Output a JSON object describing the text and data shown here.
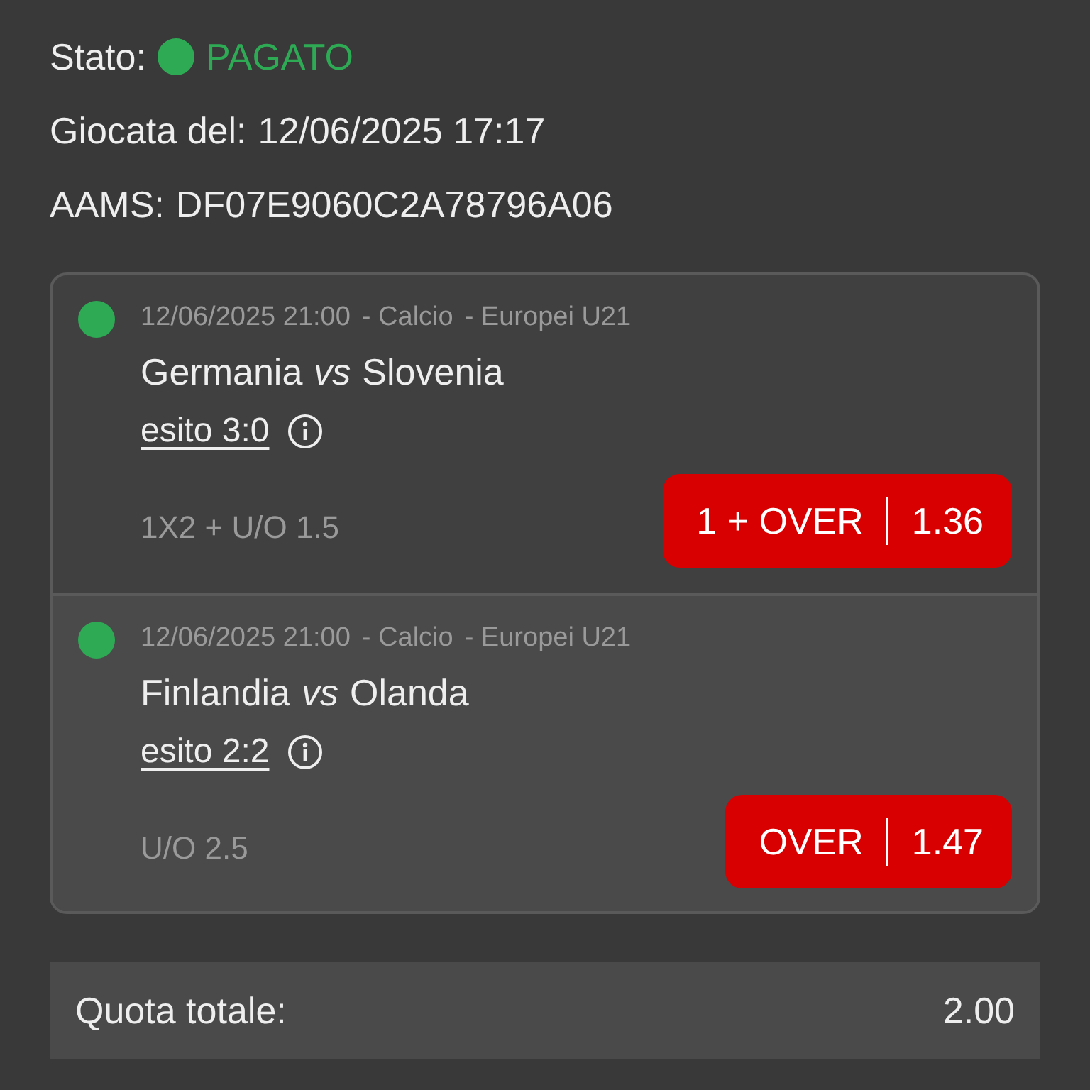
{
  "ticket": {
    "status_label": "Stato:",
    "paid": true,
    "status": "PAGATO",
    "placed_label": "Giocata del:",
    "placed": "12/06/2025 17:17",
    "aams_label": "AAMS:",
    "aams": "DF07E9060C2A78796A06"
  },
  "events": [
    {
      "color": "#2eaa55",
      "datetime": "12/06/2025 21:00",
      "sport": "- Calcio",
      "competition": "- Europei U21",
      "home": "Germania",
      "vs": "vs",
      "away": "Slovenia",
      "result": "esito 3:0",
      "market": "1X2 + U/O 1.5",
      "pick": "1 + OVER",
      "odds": "1.36"
    },
    {
      "color": "#2eaa55",
      "datetime": "12/06/2025 21:00",
      "sport": "- Calcio",
      "competition": "- Europei U21",
      "home": "Finlandia",
      "vs": "vs",
      "away": "Olanda",
      "result": "esito 2:2",
      "market": "U/O 2.5",
      "pick": "OVER",
      "odds": "1.47"
    }
  ],
  "total": {
    "label": "Quota totale:",
    "value": "2.00"
  }
}
